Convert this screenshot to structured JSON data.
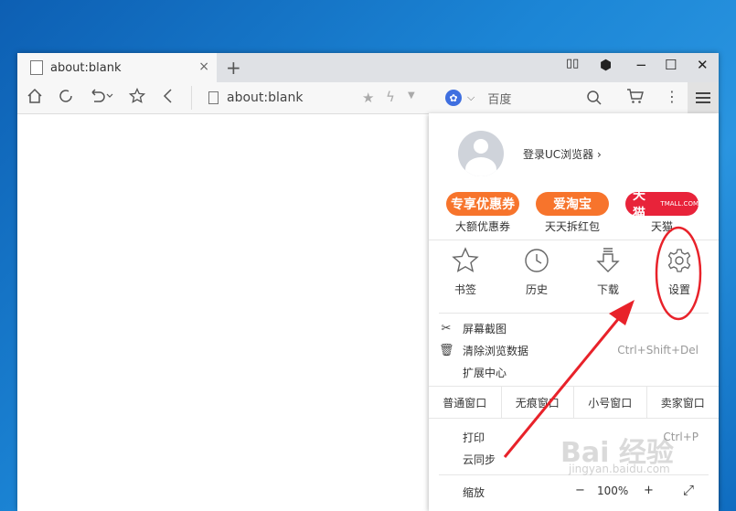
{
  "tab": {
    "title": "about:blank",
    "close": "×",
    "new": "+"
  },
  "window_controls": {
    "vr": "▯▯",
    "skin": "⬢",
    "min": "−",
    "max": "☐",
    "close": "✕"
  },
  "toolbar": {
    "address": "about:blank",
    "search_engine": "百度",
    "icons": [
      "home-icon",
      "refresh-icon",
      "undo-icon",
      "star-icon",
      "back-icon"
    ]
  },
  "menu": {
    "login": "登录UC浏览器 ›",
    "promos": [
      {
        "badge": "专享优惠券",
        "label": "大额优惠券",
        "color": "#f7742c"
      },
      {
        "badge": "爱淘宝",
        "label": "天天拆红包",
        "color": "#f7742c"
      },
      {
        "badge": "天猫",
        "label": "天猫",
        "color": "#e8233a",
        "sub": "TMALL.COM"
      }
    ],
    "grid": [
      {
        "label": "书签",
        "icon": "bookmark-star-icon"
      },
      {
        "label": "历史",
        "icon": "history-clock-icon"
      },
      {
        "label": "下载",
        "icon": "download-arrow-icon"
      },
      {
        "label": "设置",
        "icon": "settings-gear-icon"
      }
    ],
    "screenshot": "屏幕截图",
    "clear_data": "清除浏览数据",
    "clear_shortcut": "Ctrl+Shift+Del",
    "extensions": "扩展中心",
    "window_modes": [
      "普通窗口",
      "无痕窗口",
      "小号窗口",
      "卖家窗口"
    ],
    "print": "打印",
    "print_shortcut": "Ctrl+P",
    "cloud_sync": "云同步",
    "zoom_label": "缩放",
    "zoom_minus": "−",
    "zoom_value": "100%",
    "zoom_plus": "+",
    "fullscreen": "⤢"
  },
  "watermark": {
    "main": "Bai 经验",
    "sub": "jingyan.baidu.com"
  },
  "annotation_color": "#e8222a"
}
